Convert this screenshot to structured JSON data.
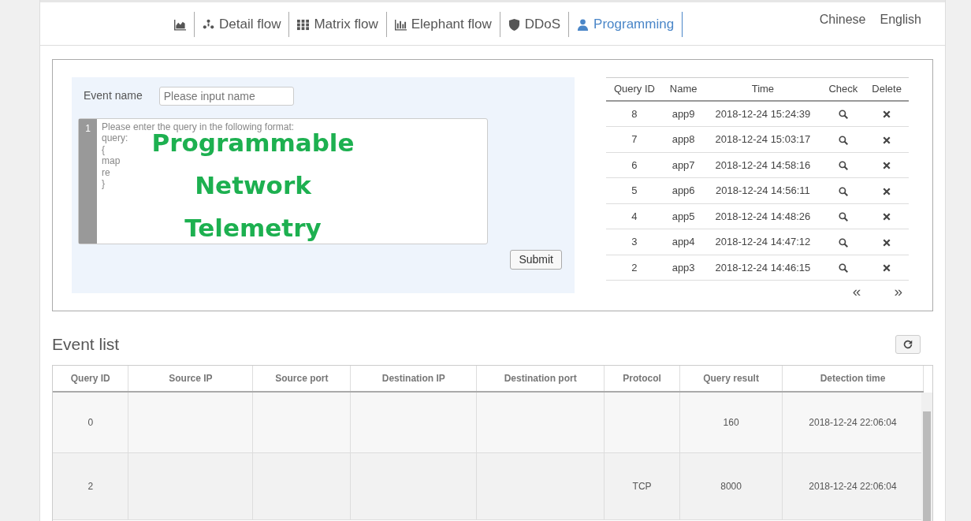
{
  "nav": {
    "items": [
      {
        "selected": false
      },
      {
        "label": "Detail flow",
        "selected": false
      },
      {
        "label": "Matrix flow",
        "selected": false
      },
      {
        "label": "Elephant flow",
        "selected": false
      },
      {
        "label": "DDoS",
        "selected": false
      },
      {
        "label": "Programming",
        "selected": true
      }
    ],
    "languages": [
      "Chinese",
      "English"
    ]
  },
  "query_form": {
    "event_name_label": "Event name",
    "event_name": {
      "placeholder": "Please input name"
    },
    "editor": {
      "line_number": "1",
      "lines": [
        "Please enter the query in the following format:",
        "query:",
        "{",
        "map",
        "re",
        "}"
      ]
    },
    "overlay_caption": [
      "Programmable",
      "Network",
      "Telemetry"
    ],
    "submit": "Submit"
  },
  "query_table": {
    "columns": [
      "Query ID",
      "Name",
      "Time",
      "Check",
      "Delete"
    ],
    "rows": [
      {
        "id": "8",
        "name": "app9",
        "time": "2018-12-24 15:24:39"
      },
      {
        "id": "7",
        "name": "app8",
        "time": "2018-12-24 15:03:17"
      },
      {
        "id": "6",
        "name": "app7",
        "time": "2018-12-24 14:58:16"
      },
      {
        "id": "5",
        "name": "app6",
        "time": "2018-12-24 14:56:11"
      },
      {
        "id": "4",
        "name": "app5",
        "time": "2018-12-24 14:48:26"
      },
      {
        "id": "3",
        "name": "app4",
        "time": "2018-12-24 14:47:12"
      },
      {
        "id": "2",
        "name": "app3",
        "time": "2018-12-24 14:46:15"
      }
    ],
    "pager": [
      "«",
      "»"
    ]
  },
  "event_list": {
    "title": "Event list",
    "columns": [
      "Query ID",
      "Source IP",
      "Source port",
      "Destination IP",
      "Destination port",
      "Protocol",
      "Query result",
      "Detection time"
    ],
    "rows": [
      [
        "0",
        "",
        "",
        "",
        "",
        "",
        "160",
        "2018-12-24 22:06:04"
      ],
      [
        "2",
        "",
        "",
        "",
        "",
        "TCP",
        "8000",
        "2018-12-24 22:06:04"
      ]
    ]
  }
}
